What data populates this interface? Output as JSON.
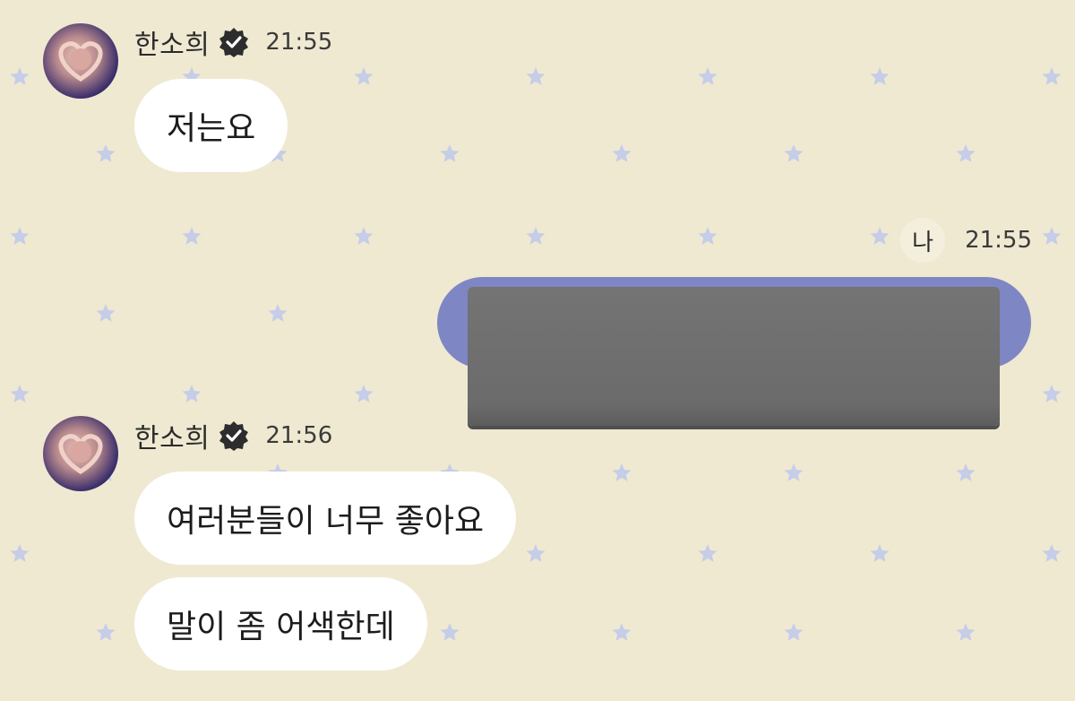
{
  "theme": {
    "background": "#efe9d2",
    "star_color": "#c5cde8",
    "bubble_color": "#ffffff",
    "my_bubble_color": "#7f86c4",
    "redaction_color": "#6e6e6e"
  },
  "messages": [
    {
      "sender": "한소희",
      "verified_icon": "verified-check-icon",
      "time": "21:55",
      "bubbles": [
        "저는요"
      ]
    },
    {
      "sender_label": "나",
      "time": "21:55",
      "bubbles": [
        "[redacted]"
      ]
    },
    {
      "sender": "한소희",
      "verified_icon": "verified-check-icon",
      "time": "21:56",
      "bubbles": [
        "여러분들이 너무 좋아요",
        "말이 좀 어색한데"
      ]
    }
  ]
}
